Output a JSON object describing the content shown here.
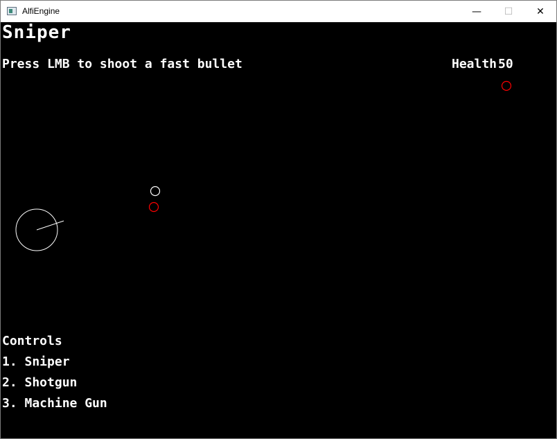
{
  "window": {
    "title": "AlfiEngine",
    "minimize_glyph": "—",
    "maximize_glyph": "☐",
    "close_glyph": "✕"
  },
  "hud": {
    "weapon_name": "Sniper",
    "hint": "Press LMB to shoot a fast bullet",
    "health_label": "Health",
    "health_value": "50"
  },
  "controls": {
    "title": "Controls",
    "items": [
      "1. Sniper",
      "2. Shotgun",
      "3. Machine Gun"
    ]
  },
  "colors": {
    "background": "#000000",
    "player": "#ffffff",
    "enemy": "#ff0000",
    "bullet": "#ffffff"
  },
  "icons": {
    "app": "window-app-icon",
    "minimize": "minimize-icon",
    "maximize": "maximize-icon",
    "close": "close-icon"
  }
}
